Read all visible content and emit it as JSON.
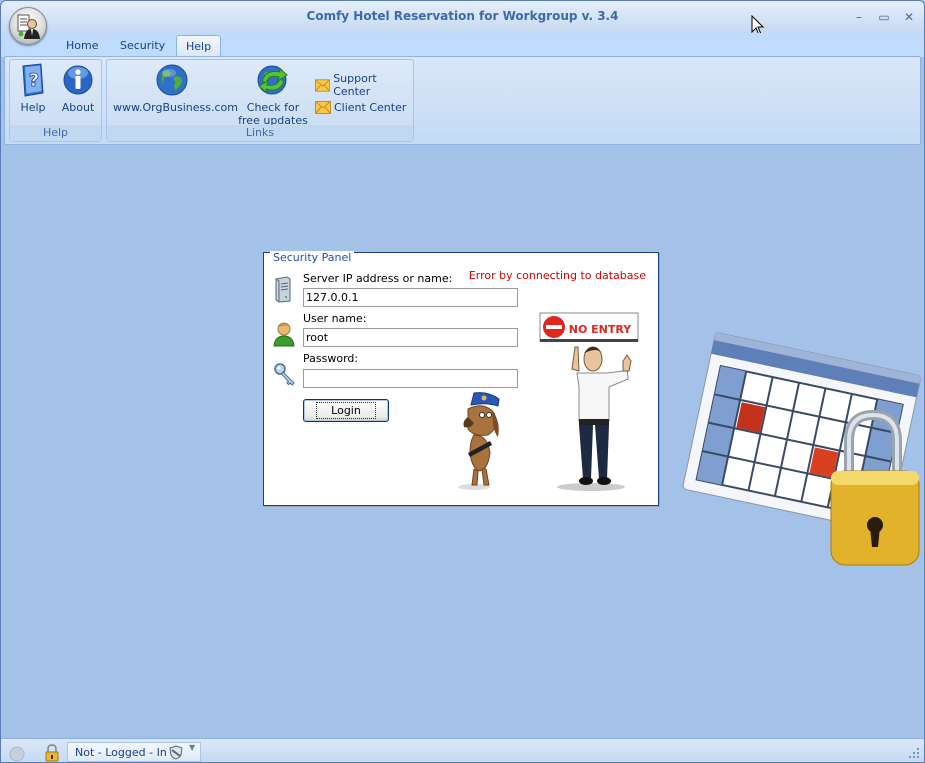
{
  "window": {
    "title": "Comfy Hotel Reservation for Workgroup v. 3.4",
    "controls": {
      "minimize": "–",
      "maximize": "▭",
      "close": "✕"
    }
  },
  "tabs": [
    {
      "label": "Home",
      "active": false
    },
    {
      "label": "Security",
      "active": false
    },
    {
      "label": "Help",
      "active": true
    }
  ],
  "ribbon": {
    "groups": [
      {
        "label": "Help",
        "buttons": [
          {
            "label": "Help",
            "icon": "help-book-icon"
          },
          {
            "label": "About",
            "icon": "info-icon"
          }
        ]
      },
      {
        "label": "Links",
        "buttons": [
          {
            "label": "www.OrgBusiness.com",
            "icon": "globe-icon"
          },
          {
            "label_line1": "Check for",
            "label_line2": "free updates",
            "icon": "globe-update-icon"
          }
        ],
        "small_buttons": [
          {
            "label": "Support Center",
            "icon": "envelope-icon"
          },
          {
            "label": "Client Center",
            "icon": "envelope-icon"
          }
        ]
      }
    ]
  },
  "security_panel": {
    "legend": "Security Panel",
    "error": "Error by connecting to database",
    "error_color": "#d40000",
    "server": {
      "label": "Server IP address or name:",
      "value": "127.0.0.1"
    },
    "username": {
      "label": "User name:",
      "value": "root"
    },
    "password": {
      "label": "Password:",
      "value": ""
    },
    "login_label": "Login",
    "sign_text": "NO ENTRY"
  },
  "statusbar": {
    "status": "Not - Logged - In"
  },
  "colors": {
    "workspace": "#a4c2e8",
    "title_text": "#3e6aaa",
    "ribbon_text": "#15428b"
  }
}
